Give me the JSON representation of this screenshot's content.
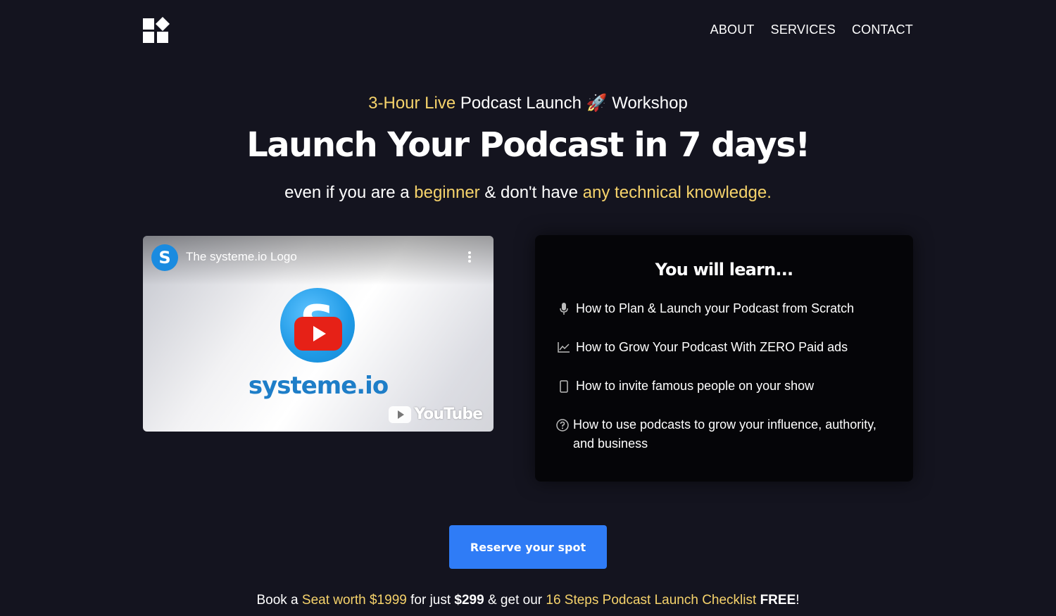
{
  "header": {
    "logo_icon": "blocks-logo-icon",
    "nav": [
      "ABOUT",
      "SERVICES",
      "CONTACT"
    ]
  },
  "hero": {
    "eyebrow_highlight": "3-Hour Live",
    "eyebrow_middle": " Podcast Launch ",
    "eyebrow_emoji": "🚀",
    "eyebrow_end": " Workshop",
    "headline": "Launch Your Podcast in 7 days!",
    "sub_1": "even if you are a ",
    "sub_hl_1": "beginner",
    "sub_2": " & don't have ",
    "sub_hl_2": "any technical knowledge."
  },
  "video": {
    "channel_initial": "S",
    "title": "The systeme.io Logo",
    "brand_letter": "S",
    "brand_name": "systeme.io",
    "platform": "YouTube"
  },
  "learn": {
    "title": "You will learn...",
    "items": [
      {
        "icon": "microphone-icon",
        "text": "How to Plan & Launch your Podcast from Scratch"
      },
      {
        "icon": "line-chart-icon",
        "text": "How to Grow Your Podcast With ZERO Paid ads"
      },
      {
        "icon": "phone-icon",
        "text": "How to invite famous people on your show"
      },
      {
        "icon": "question-circle-icon",
        "text": "How to use podcasts to grow your influence, authority, and business"
      }
    ]
  },
  "cta": {
    "label": "Reserve your spot"
  },
  "offer": {
    "p1": "Book a ",
    "hl1": "Seat worth $1999",
    "p2": " for just ",
    "price": "$299",
    "p3": " & get our ",
    "hl2": "16 Steps Podcast Launch Checklist",
    "free": "FREE",
    "p4": "!"
  },
  "colors": {
    "background": "#14141f",
    "highlight": "#f6d36b",
    "button": "#2f7cf6",
    "card": "#050508"
  }
}
